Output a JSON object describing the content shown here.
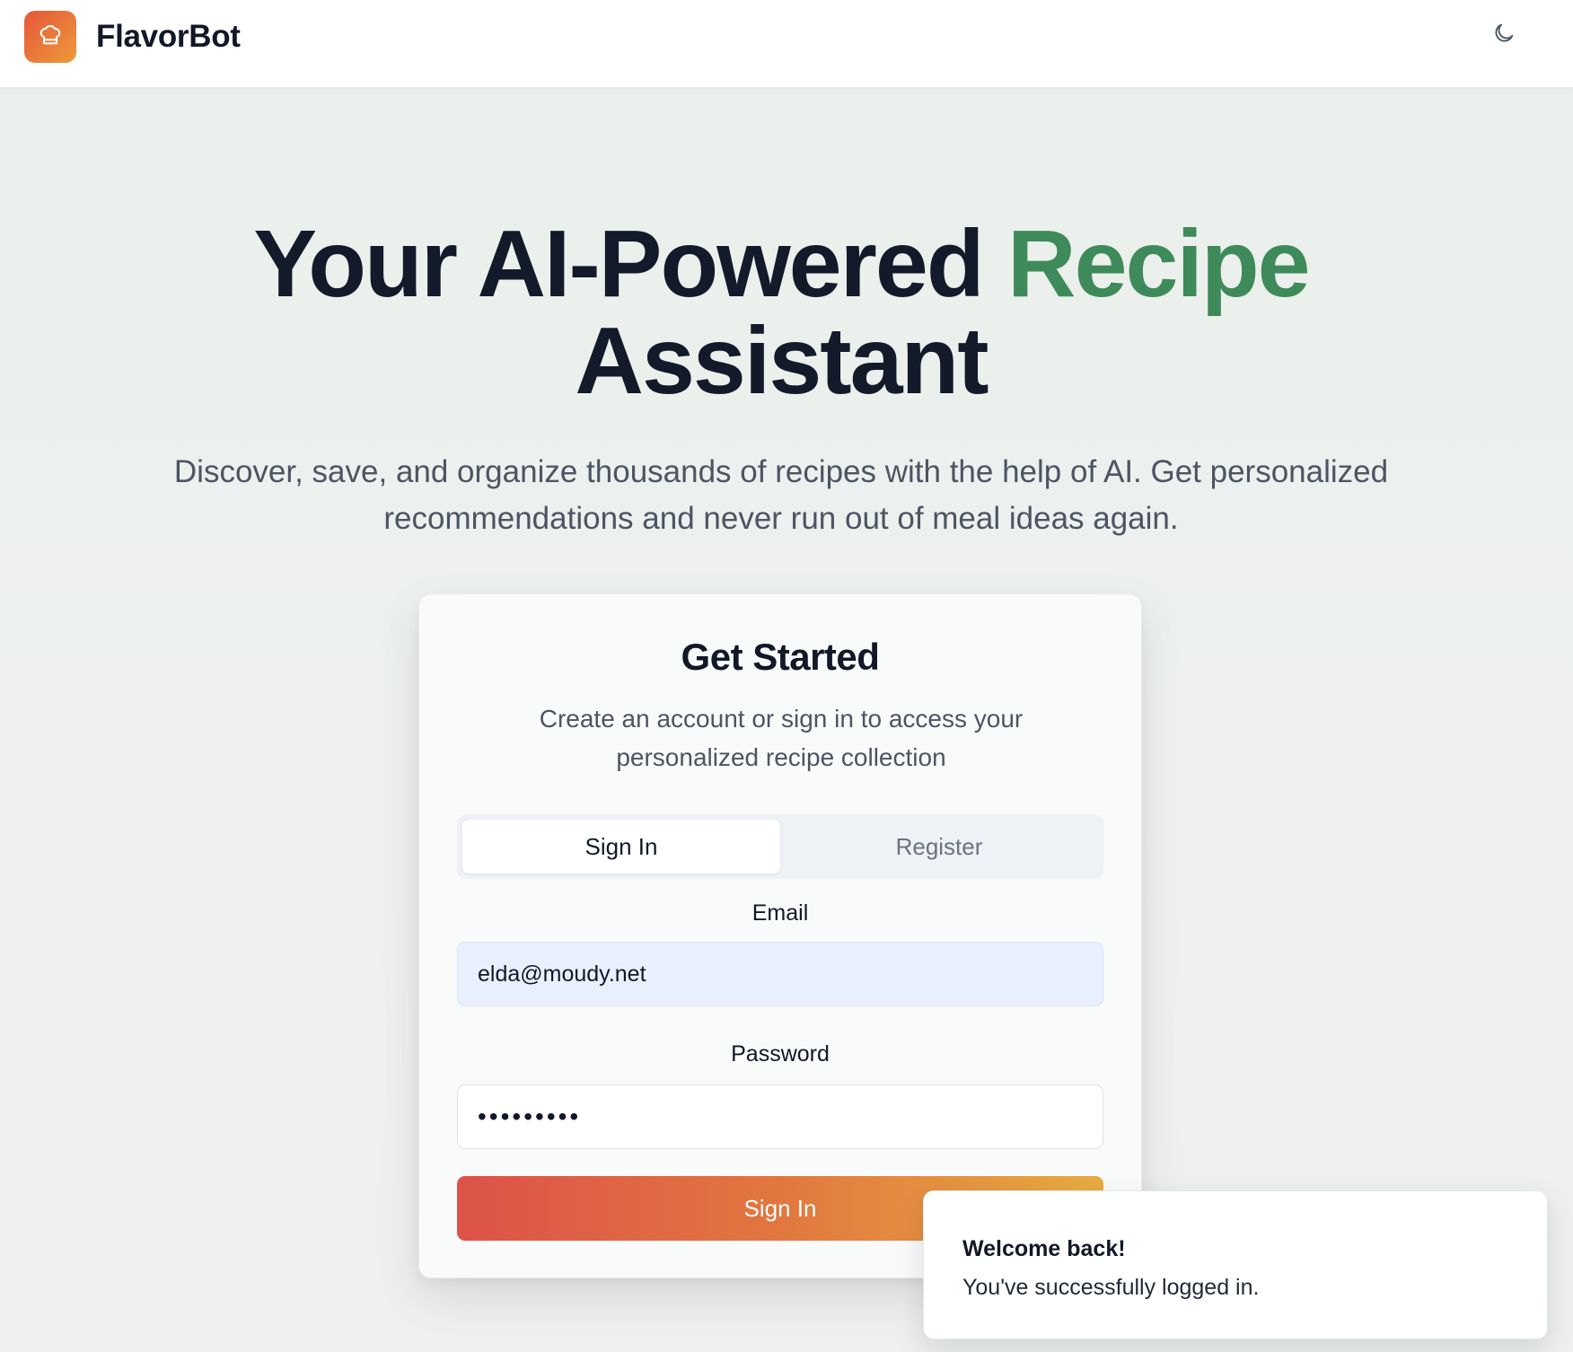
{
  "header": {
    "app_name": "FlavorBot",
    "logo_icon": "chef-hat-icon",
    "theme_toggle_icon": "moon-icon"
  },
  "hero": {
    "title_part1": "Your AI-Powered ",
    "title_accent": "Recipe",
    "title_part2": "Assistant",
    "subtitle": "Discover, save, and organize thousands of recipes with the help of AI. Get personalized recommendations and never run out of meal ideas again."
  },
  "auth_card": {
    "title": "Get Started",
    "description": "Create an account or sign in to access your personalized recipe collection",
    "tabs": [
      {
        "label": "Sign In",
        "active": true
      },
      {
        "label": "Register",
        "active": false
      }
    ],
    "email": {
      "label": "Email",
      "value": "elda@moudy.net"
    },
    "password": {
      "label": "Password",
      "value": "•••••••••"
    },
    "submit_label": "Sign In"
  },
  "toast": {
    "title": "Welcome back!",
    "message": "You've successfully logged in."
  },
  "colors": {
    "accent_green": "#3f8a5a",
    "brand_gradient_start": "#dd5249",
    "brand_gradient_end": "#e8ac42"
  }
}
